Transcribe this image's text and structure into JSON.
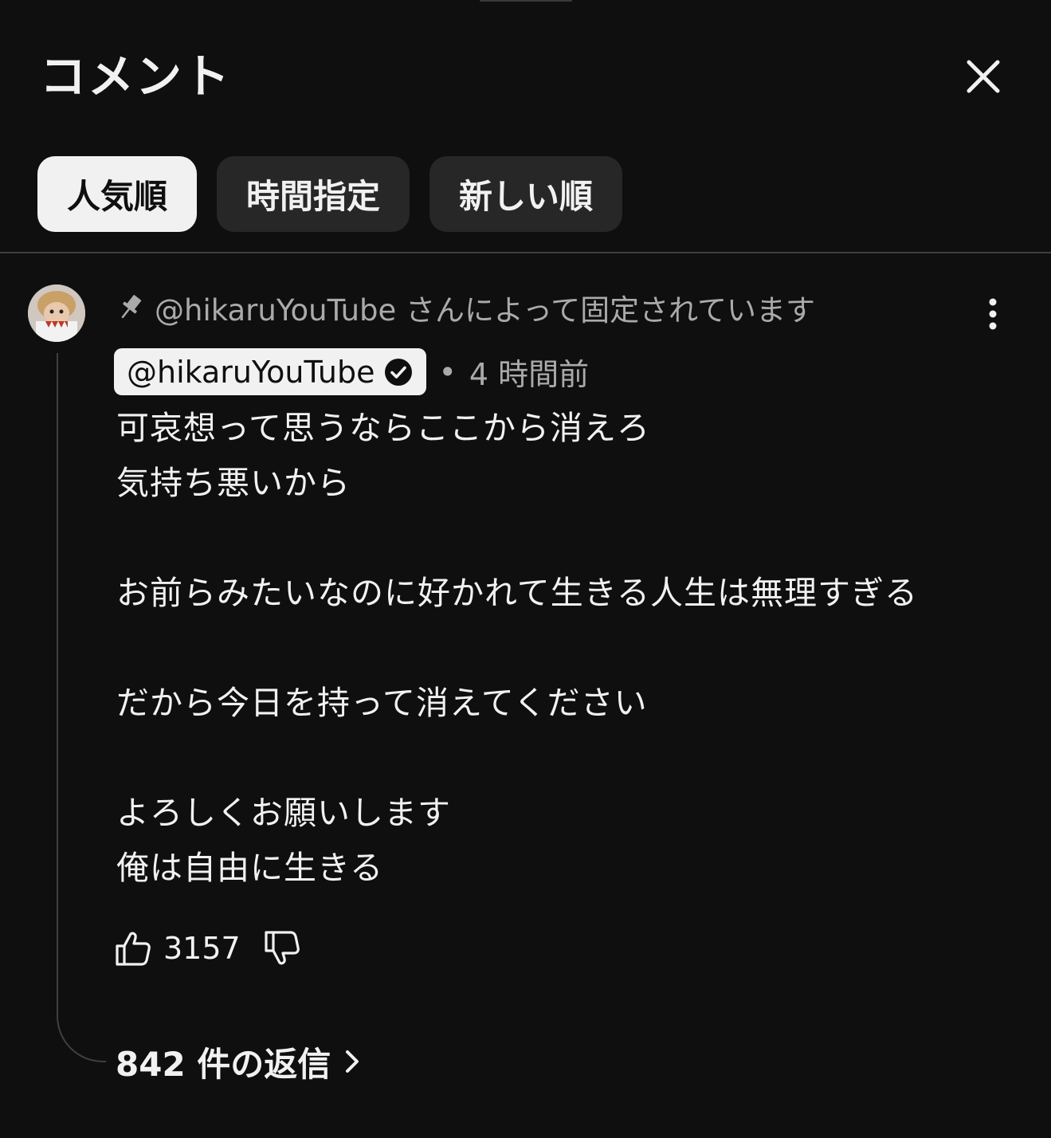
{
  "header": {
    "title": "コメント"
  },
  "sort_chips": [
    {
      "label": "人気順",
      "selected": true
    },
    {
      "label": "時間指定",
      "selected": false
    },
    {
      "label": "新しい順",
      "selected": false
    }
  ],
  "comment": {
    "pinned_text": "@hikaruYouTube さんによって固定されています",
    "author": "@hikaruYouTube",
    "verified": true,
    "separator": "•",
    "timestamp": "4 時間前",
    "body_lines": [
      "可哀想って思うならここから消えろ",
      "気持ち悪いから",
      "",
      "お前らみたいなのに好かれて生きる人生は無理すぎる",
      "",
      "だから今日を持って消えてください",
      "",
      "よろしくお願いします",
      "俺は自由に生きる"
    ],
    "like_count": "3157",
    "replies_label": "842 件の返信"
  },
  "icons": {
    "close": "close-icon",
    "pin": "pin-icon",
    "more": "more-vert-icon",
    "verified": "verified-check-icon",
    "like": "thumbs-up-icon",
    "dislike": "thumbs-down-icon",
    "chevron": "chevron-right-icon"
  },
  "colors": {
    "background": "#0f0f0f",
    "chip": "#272727",
    "chip_active": "#f1f1f1",
    "text_primary": "#f1f1f1",
    "text_secondary": "#aaaaaa",
    "divider": "#3f3f3f"
  }
}
